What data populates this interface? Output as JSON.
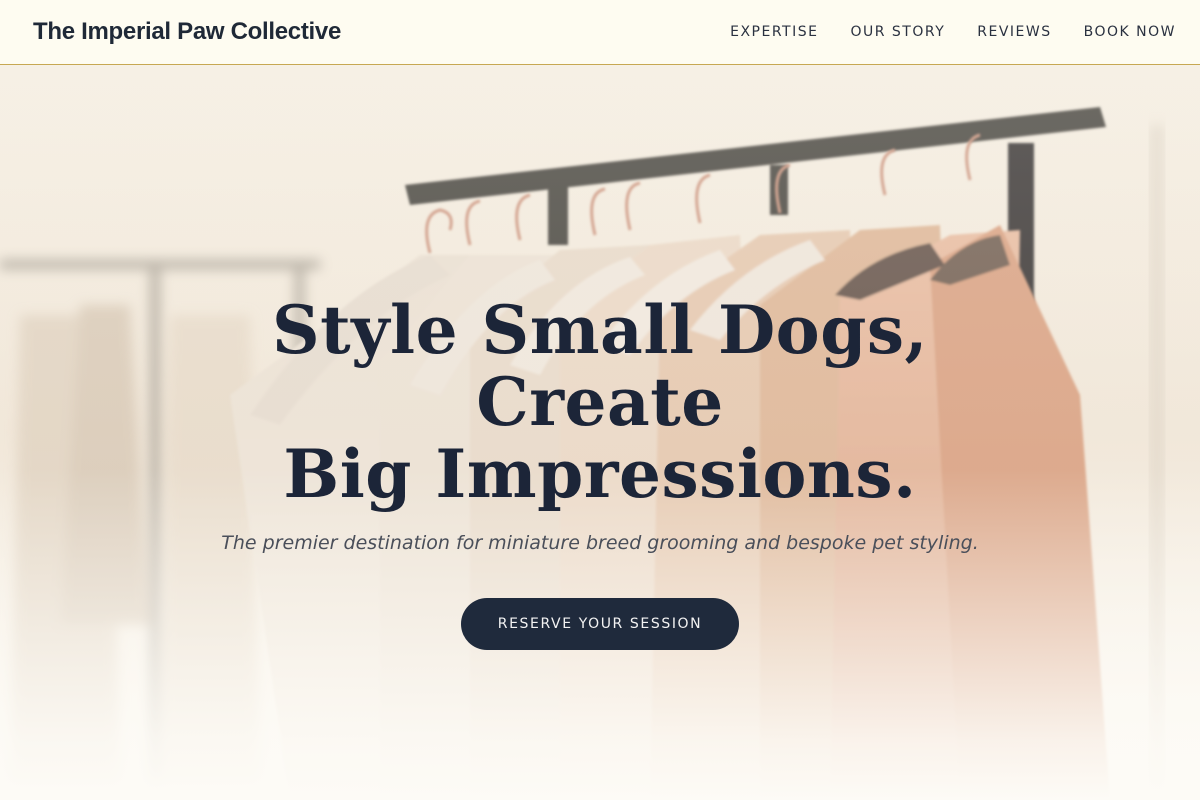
{
  "header": {
    "brand": "The Imperial Paw Collective",
    "nav": [
      {
        "label": "EXPERTISE"
      },
      {
        "label": "OUR STORY"
      },
      {
        "label": "REVIEWS"
      },
      {
        "label": "BOOK NOW"
      }
    ]
  },
  "hero": {
    "title_line1": "Style Small Dogs, Create",
    "title_line2": "Big Impressions.",
    "subtitle": "The premier destination for miniature breed grooming and bespoke pet styling.",
    "cta_label": "RESERVE YOUR SESSION",
    "background_image": "clothing-rack-with-hangers"
  },
  "colors": {
    "header_bg": "#fefcf1",
    "header_border": "#c7a852",
    "text_dark": "#1c2538",
    "cta_bg": "#1f2a3c",
    "hanger_copper": "#c98f78"
  }
}
